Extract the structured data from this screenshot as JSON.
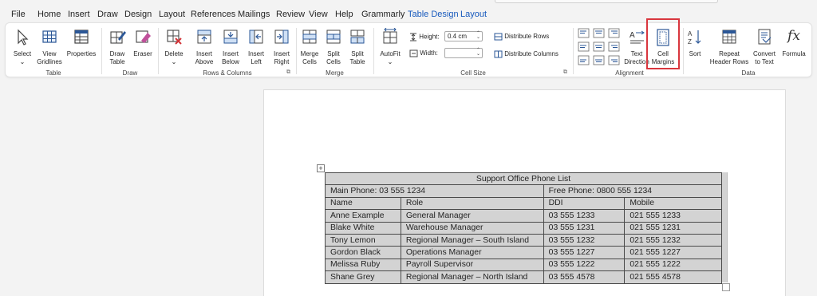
{
  "menu": {
    "tabs": [
      "File",
      "Home",
      "Insert",
      "Draw",
      "Design",
      "Layout",
      "References",
      "Mailings",
      "Review",
      "View",
      "Help",
      "Grammarly",
      "Table Design",
      "Layout"
    ]
  },
  "ribbon": {
    "table_group": {
      "label": "Table",
      "select": "Select",
      "view_gridlines_1": "View",
      "view_gridlines_2": "Gridlines",
      "properties": "Properties"
    },
    "draw_group": {
      "label": "Draw",
      "draw_table_1": "Draw",
      "draw_table_2": "Table",
      "eraser": "Eraser"
    },
    "rows_cols_group": {
      "label": "Rows & Columns",
      "delete": "Delete",
      "insert_above_1": "Insert",
      "insert_above_2": "Above",
      "insert_below_1": "Insert",
      "insert_below_2": "Below",
      "insert_left_1": "Insert",
      "insert_left_2": "Left",
      "insert_right_1": "Insert",
      "insert_right_2": "Right"
    },
    "merge_group": {
      "label": "Merge",
      "merge_cells_1": "Merge",
      "merge_cells_2": "Cells",
      "split_cells_1": "Split",
      "split_cells_2": "Cells",
      "split_table_1": "Split",
      "split_table_2": "Table"
    },
    "cell_size_group": {
      "label": "Cell Size",
      "autofit": "AutoFit",
      "height_label": "Height:",
      "height_value": "0.4 cm",
      "width_label": "Width:",
      "width_value": "",
      "distribute_rows": "Distribute Rows",
      "distribute_columns": "Distribute Columns"
    },
    "alignment_group": {
      "label": "Alignment",
      "text_direction_1": "Text",
      "text_direction_2": "Direction",
      "cell_margins_1": "Cell",
      "cell_margins_2": "Margins"
    },
    "data_group": {
      "label": "Data",
      "sort": "Sort",
      "repeat_header_1": "Repeat",
      "repeat_header_2": "Header Rows",
      "convert_1": "Convert",
      "convert_2": "to Text",
      "formula": "Formula"
    }
  },
  "document": {
    "table": {
      "title": "Support Office Phone List",
      "main_phone": "Main Phone: 03 555 1234",
      "free_phone": "Free Phone: 0800 555 1234",
      "headers": [
        "Name",
        "Role",
        "DDI",
        "Mobile"
      ],
      "rows": [
        [
          "Anne Example",
          "General Manager",
          "03 555 1233",
          "021 555 1233"
        ],
        [
          "Blake White",
          "Warehouse Manager",
          "03 555 1231",
          "021 555 1231"
        ],
        [
          "Tony Lemon",
          "Regional Manager – South Island",
          "03 555 1232",
          "021 555 1232"
        ],
        [
          "Gordon Black",
          "Operations Manager",
          "03 555 1227",
          "021 555 1227"
        ],
        [
          "Melissa Ruby",
          "Payroll Supervisor",
          "03 555 1222",
          "021 555 1222"
        ],
        [
          "Shane Grey",
          "Regional Manager – North Island",
          "03 555 4578",
          "021 555 4578"
        ]
      ]
    }
  },
  "colors": {
    "accent": "#185abd",
    "highlight_box": "#d9363e",
    "table_fill": "#d3d3d3"
  }
}
